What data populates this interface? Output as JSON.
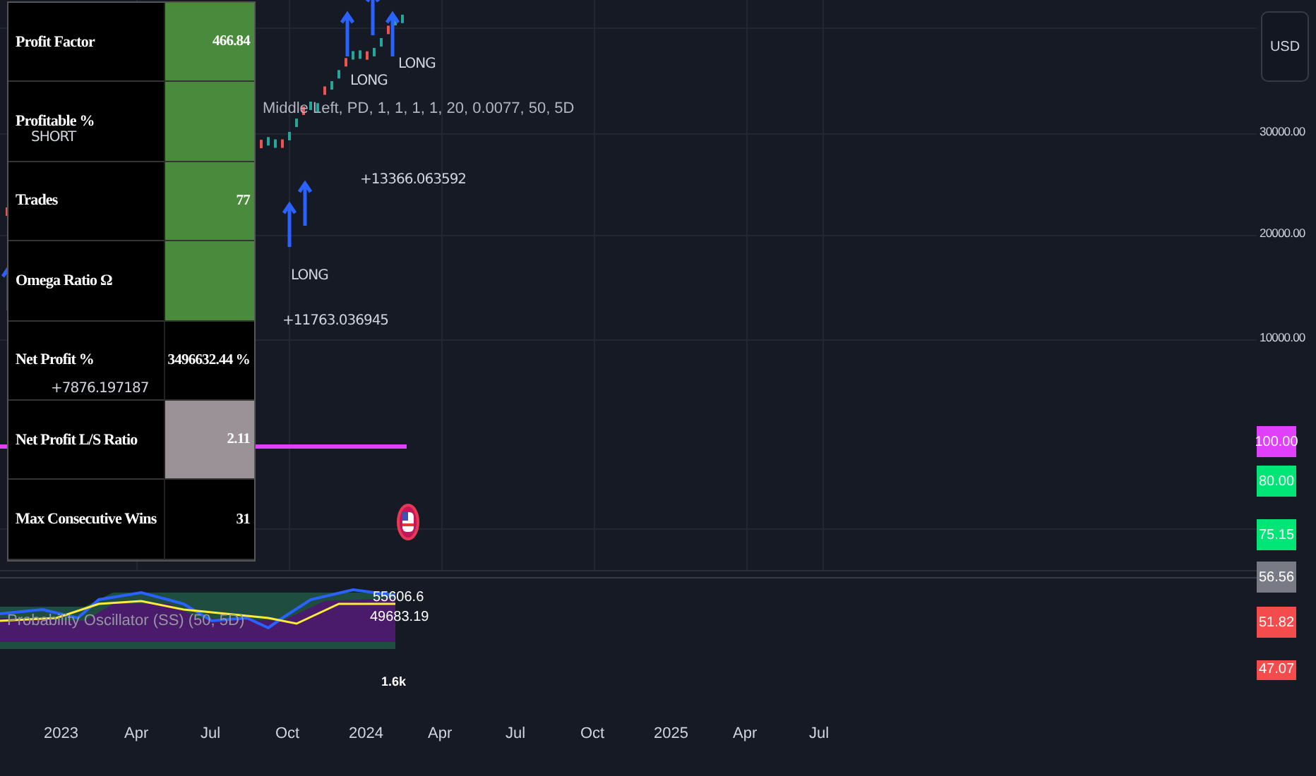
{
  "stats_table": {
    "rows": [
      {
        "label": "Profit Factor",
        "value": "466.84",
        "color": "#4a8a3c"
      },
      {
        "label": "Profitable %",
        "value": "",
        "color": "#4a8a3c"
      },
      {
        "label": "Trades",
        "value": "77",
        "color": "#4a8a3c"
      },
      {
        "label": "Omega Ratio Ω",
        "value": "",
        "color": "#4a8a3c"
      },
      {
        "label": "Net Profit %",
        "value": "3496632.44 %",
        "color": "#000000"
      },
      {
        "label": "Net Profit L/S Ratio",
        "value": "2.11",
        "color": "#9a9297"
      },
      {
        "label": "Max Consecutive Wins",
        "value": "31",
        "color": "#000000"
      }
    ]
  },
  "strategy_legend": "Middle Left, PD, 1, 1, 1, 1, 20, 0.0077, 50, 5D",
  "signals": [
    {
      "kind": "short",
      "text": "SHORT"
    },
    {
      "kind": "long",
      "text": "LONG"
    },
    {
      "kind": "long",
      "text": "LONG"
    },
    {
      "kind": "long",
      "text": "LONG"
    },
    {
      "kind": "profit",
      "text": "+13366.063592"
    },
    {
      "kind": "profit",
      "text": "+11763.036945"
    },
    {
      "kind": "profit",
      "text": "+7876.197187"
    }
  ],
  "price_axis": {
    "currency": "USD",
    "labels": [
      "30000.00",
      "20000.00",
      "10000.00"
    ],
    "badges": [
      {
        "text": "100.00",
        "color": "#e040fb"
      },
      {
        "text": "80.00",
        "color": "#00e676"
      },
      {
        "text": "75.15",
        "color": "#00e676"
      },
      {
        "text": "56.56",
        "color": "#787b86"
      },
      {
        "text": "51.82",
        "color": "#f44c4c"
      },
      {
        "text": "47.07",
        "color": "#f44c4c"
      }
    ]
  },
  "oscillator": {
    "legend": "Probability Oscillator (SS) (50, 5D)",
    "values": [
      "55606.6",
      "49683.19",
      "1.6k"
    ]
  },
  "time_axis": [
    "2023",
    "Apr",
    "Jul",
    "Oct",
    "2024",
    "Apr",
    "Jul",
    "Oct",
    "2025",
    "Apr",
    "Jul"
  ]
}
